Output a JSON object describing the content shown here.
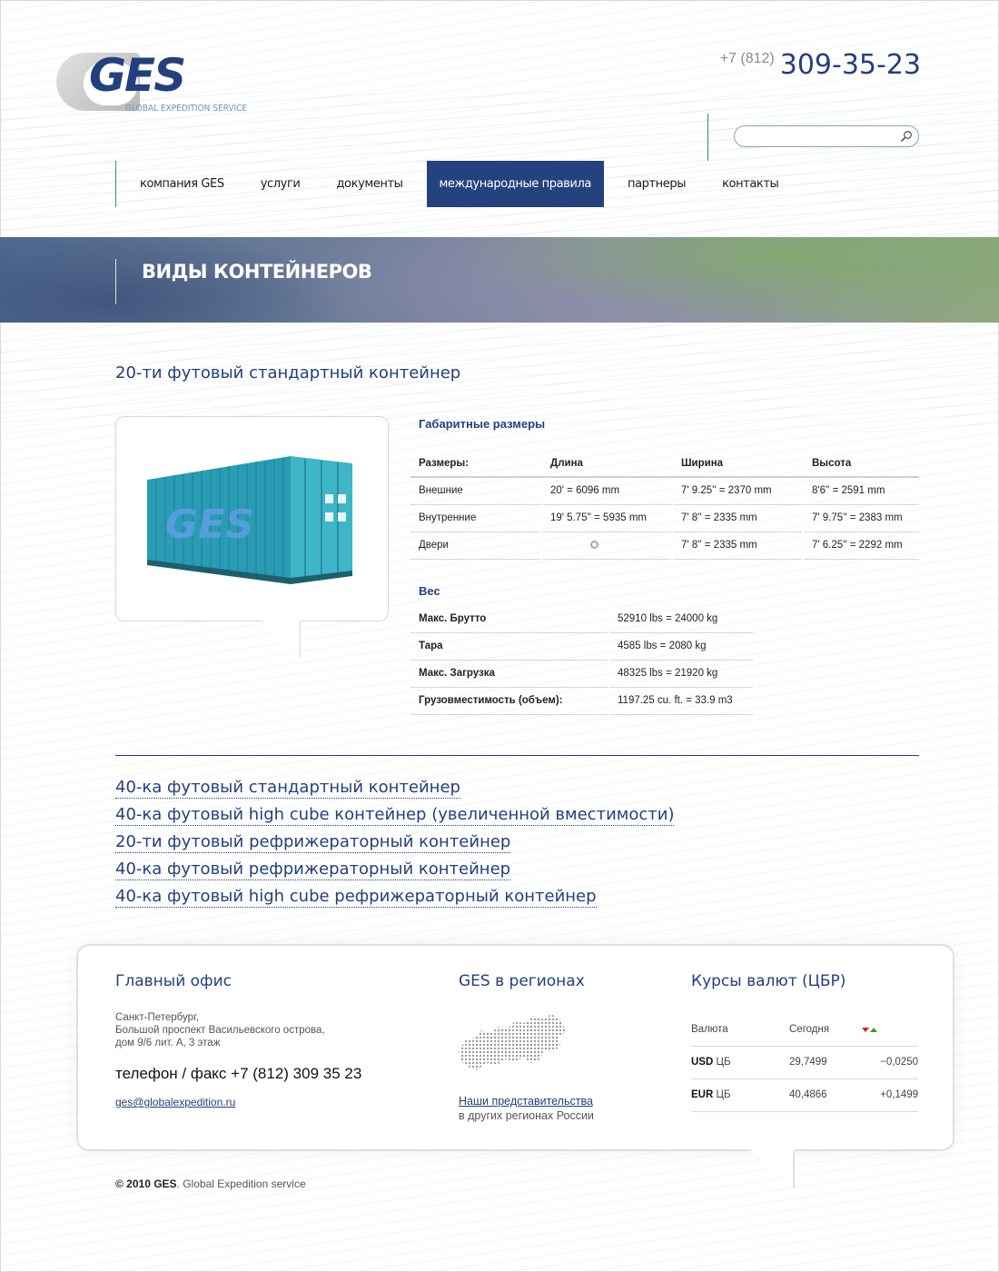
{
  "logo": {
    "name": "GES",
    "tagline": "GLOBAL EXPEDITION SERVICE"
  },
  "header": {
    "phone_code": "+7 (812)",
    "phone_number": "309-35-23",
    "search_placeholder": ""
  },
  "nav": {
    "items": [
      {
        "label": "компания GES",
        "active": false
      },
      {
        "label": "услуги",
        "active": false
      },
      {
        "label": "документы",
        "active": false
      },
      {
        "label": "международные правила",
        "active": true
      },
      {
        "label": "партнеры",
        "active": false
      },
      {
        "label": "контакты",
        "active": false
      }
    ]
  },
  "banner": {
    "title": "ВИДЫ КОНТЕЙНЕРОВ"
  },
  "main": {
    "section_title": "20-ти футовый стандартный контейнер",
    "container_logo": "GES",
    "container_color": "#2a9cb3",
    "dimensions": {
      "title": "Габаритные размеры",
      "headers": [
        "Размеры:",
        "Длина",
        "Ширина",
        "Высота"
      ],
      "rows": [
        [
          "Внешние",
          "20' = 6096 mm",
          "7' 9.25'' = 2370 mm",
          "8'6'' = 2591 mm"
        ],
        [
          "Внутренние",
          "19' 5.75'' = 5935 mm",
          "7' 8'' = 2335 mm",
          "7' 9.75'' = 2383 mm"
        ],
        [
          "Двери",
          "",
          "7' 8'' = 2335 mm",
          "7' 6.25'' = 2292 mm"
        ]
      ]
    },
    "weight": {
      "title": "Вес",
      "rows": [
        [
          "Макс. Брутто",
          "52910 lbs = 24000 kg"
        ],
        [
          "Тара",
          "4585 lbs = 2080 kg"
        ],
        [
          "Макс. Загрузка",
          "48325 lbs = 21920 kg"
        ],
        [
          "Грузовместимость (объем):",
          "1197.25 cu. ft. = 33.9 m3"
        ]
      ]
    },
    "links": [
      "40-ка футовый стандартный контейнер",
      "40-ка футовый high cube контейнер (увеличенной вместимости)",
      "20-ти футовый рефрижераторный контейнер",
      "40-ка футовый рефрижераторный контейнер",
      "40-ка футовый high cube рефрижераторный контейнер"
    ]
  },
  "footer": {
    "office": {
      "heading": "Главный офис",
      "address": [
        "Санкт-Петербург,",
        "Большой проспект Васильевского острова,",
        "дом 9/6 лит. А, 3 этаж"
      ],
      "phone": "телефон / факс +7 (812) 309 35 23",
      "email": "ges@globalexpedition.ru"
    },
    "regions": {
      "heading": "GES в регионах",
      "link": "Наши представительства",
      "sub": "в других регионах России"
    },
    "rates": {
      "heading": "Курсы валют (ЦБР)",
      "headers": [
        "Валюта",
        "Сегодня"
      ],
      "rows": [
        {
          "code": "USD",
          "suffix": " ЦБ",
          "today": "29,7499",
          "change": "−0,0250",
          "direction": "down"
        },
        {
          "code": "EUR",
          "suffix": " ЦБ",
          "today": "40,4866",
          "change": "+0,1499",
          "direction": "up"
        }
      ]
    },
    "copyright_bold": "© 2010 GES",
    "copyright_rest": ". Global Expedition service"
  },
  "colors": {
    "brand_blue": "#23407e",
    "accent_green": "#3f8a5f",
    "negative": "#d32020",
    "positive": "#3b9a2c"
  }
}
